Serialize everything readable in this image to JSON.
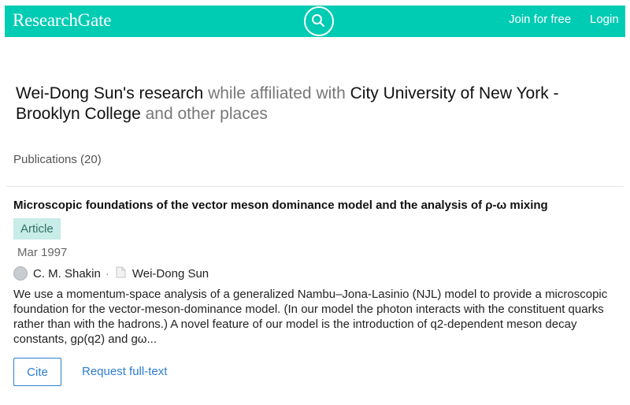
{
  "header": {
    "logo": "ResearchGate",
    "join_label": "Join for free",
    "login_label": "Login",
    "search_icon": "search-icon",
    "brand_color": "#00cbb3"
  },
  "profile": {
    "name_part": "Wei-Dong Sun's research",
    "affiliated_text": "while affiliated with",
    "institution": "City University of New York - Brooklyn College",
    "other_text": "and other places"
  },
  "publications": {
    "label": "Publications (20)"
  },
  "item": {
    "title": "Microscopic foundations of the vector meson dominance model and the analysis of ρ-ω mixing",
    "badge": "Article",
    "date": "Mar 1997",
    "authors": [
      "C. M. Shakin",
      "Wei-Dong Sun"
    ],
    "separator": "·",
    "abstract": "We use a momentum-space analysis of a generalized Nambu–Jona-Lasinio (NJL) model to provide a microscopic foundation for the vector-meson-dominance model. (In our model the photon interacts with the constituent quarks rather than with the hadrons.) A novel feature of our model is the introduction of q2-dependent meson decay constants, gρ(q2) and gω...",
    "cite_label": "Cite",
    "request_label": "Request full-text",
    "link_color": "#2d7dd2"
  }
}
